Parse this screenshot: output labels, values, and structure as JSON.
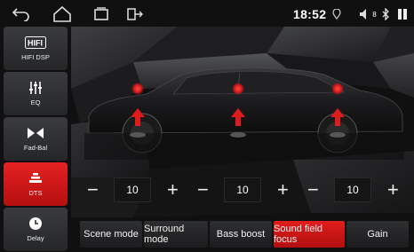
{
  "status_bar": {
    "back_icon": "back-arrow-icon",
    "home_icon": "home-icon",
    "recent_icon": "recent-apps-icon",
    "screen_icon": "screen-share-icon",
    "time": "18:52",
    "location_icon": "location-icon",
    "volume_label": "8",
    "bluetooth_icon": "bluetooth-icon",
    "menu_icon": "two-bar-icon"
  },
  "sidebar": {
    "items": [
      {
        "label": "HIFI DSP",
        "icon": "hifi-icon"
      },
      {
        "label": "EQ",
        "icon": "equalizer-icon"
      },
      {
        "label": "Fad-Bal",
        "icon": "bowtie-icon"
      },
      {
        "label": "DTS",
        "icon": "dts-icon",
        "active": true
      },
      {
        "label": "Delay",
        "icon": "clock-icon"
      }
    ]
  },
  "controls": [
    {
      "value": "10",
      "minus": "−",
      "plus": "+"
    },
    {
      "value": "10",
      "minus": "−",
      "plus": "+"
    },
    {
      "value": "10",
      "minus": "−",
      "plus": "+"
    }
  ],
  "tabs": [
    {
      "label": "Scene mode"
    },
    {
      "label": "Surround mode"
    },
    {
      "label": "Bass boost"
    },
    {
      "label": "Sound field focus",
      "active": true
    },
    {
      "label": "Gain"
    }
  ],
  "colors": {
    "accent": "#e01b1b",
    "panel": "#2b2c2e",
    "background": "#0c0c0d"
  }
}
